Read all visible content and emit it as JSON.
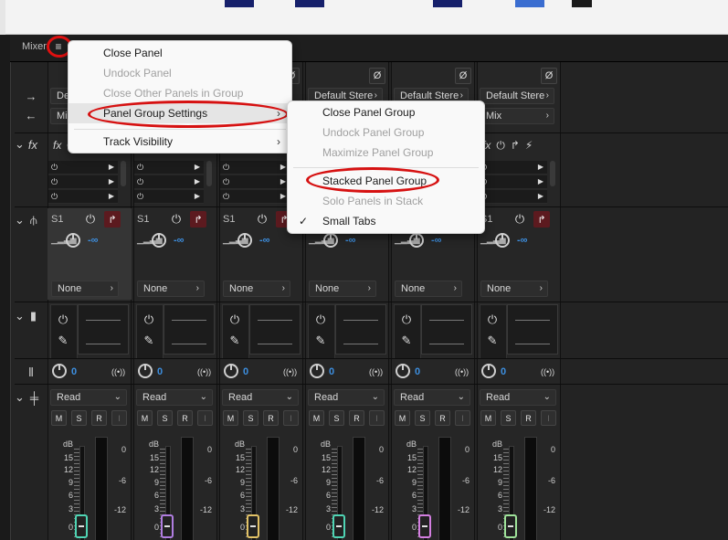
{
  "panel": {
    "tab_label": "Mixer"
  },
  "menu": {
    "items": [
      {
        "label": "Close Panel",
        "disabled": false
      },
      {
        "label": "Undock Panel",
        "disabled": true
      },
      {
        "label": "Close Other Panels in Group",
        "disabled": true
      },
      {
        "label": "Panel Group Settings",
        "disabled": false
      },
      {
        "label": "Track Visibility",
        "disabled": false
      }
    ]
  },
  "submenu": {
    "items": [
      {
        "label": "Close Panel Group",
        "disabled": false
      },
      {
        "label": "Undock Panel Group",
        "disabled": true
      },
      {
        "label": "Maximize Panel Group",
        "disabled": true
      },
      {
        "label": "Stacked Panel Group",
        "disabled": false
      },
      {
        "label": "Solo Panels in Stack",
        "disabled": true
      },
      {
        "label": "Small Tabs",
        "disabled": false,
        "checked": true
      }
    ]
  },
  "io": {
    "input_label": "Default Stere",
    "output_label": "Mix"
  },
  "strips": [
    {
      "cap_color": "#4fd5b4"
    },
    {
      "cap_color": "#b07de0"
    },
    {
      "cap_color": "#e2c266"
    },
    {
      "cap_color": "#4fd5b4"
    },
    {
      "cap_color": "#d37ee0"
    },
    {
      "cap_color": "#9fe39a"
    }
  ],
  "send": {
    "label": "S1",
    "pan_value": "-∞",
    "dest_label": "None"
  },
  "panner": {
    "value": "0"
  },
  "automation": {
    "mode": "Read"
  },
  "buttons": {
    "m": "M",
    "s": "S",
    "r": "R",
    "i": "I"
  },
  "fader": {
    "db_label": "dB",
    "scale": [
      "15",
      "12",
      "9",
      "6",
      "3",
      "0"
    ],
    "meter_scale": [
      "0",
      "-6",
      "-12"
    ]
  },
  "fx_label": "fx"
}
